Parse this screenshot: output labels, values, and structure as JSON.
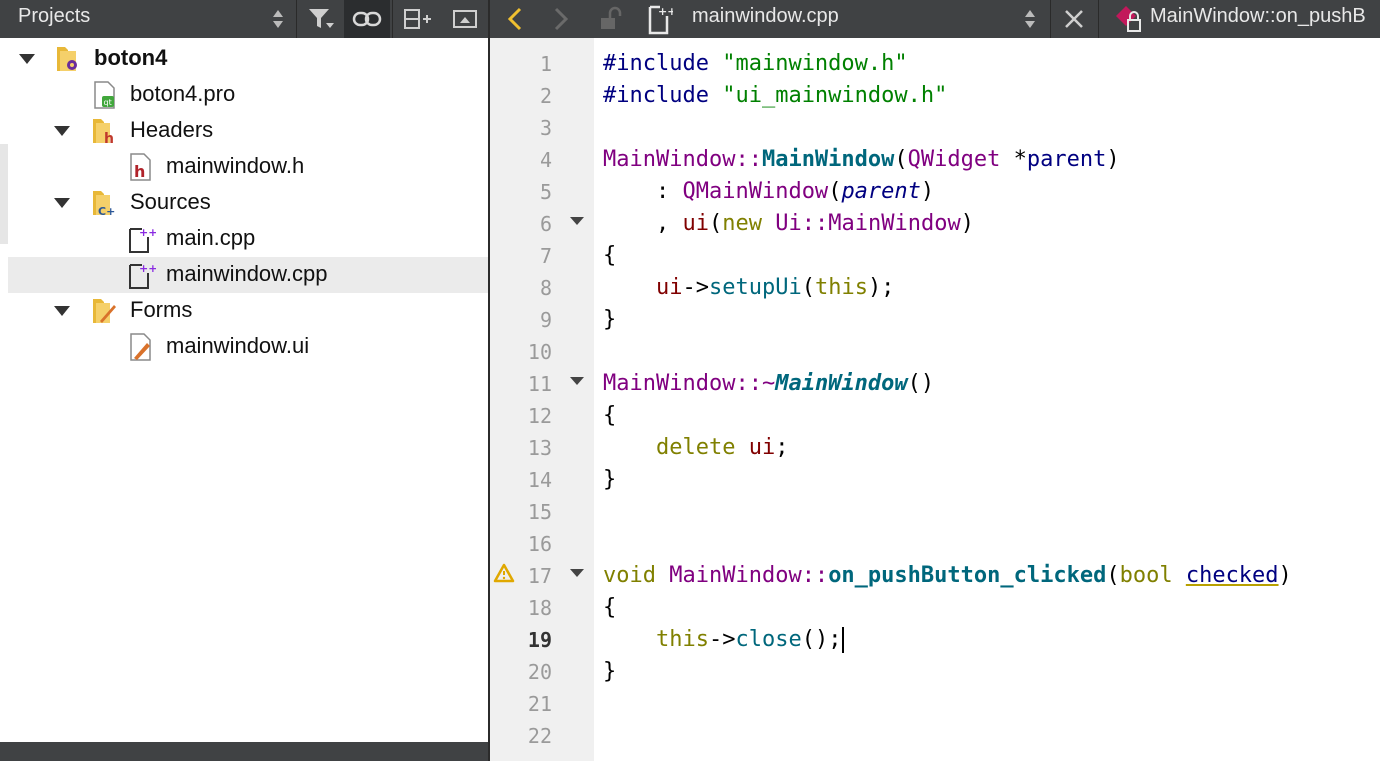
{
  "projects_panel": {
    "title": "Projects",
    "tree": [
      {
        "label": "boton4",
        "icon": "project-folder-icon",
        "expanded": true,
        "bold": true
      },
      {
        "label": "boton4.pro",
        "icon": "pro-file-icon"
      },
      {
        "label": "Headers",
        "icon": "headers-folder-icon",
        "expanded": true
      },
      {
        "label": "mainwindow.h",
        "icon": "header-file-icon"
      },
      {
        "label": "Sources",
        "icon": "sources-folder-icon",
        "expanded": true
      },
      {
        "label": "main.cpp",
        "icon": "cpp-file-icon"
      },
      {
        "label": "mainwindow.cpp",
        "icon": "cpp-file-icon",
        "selected": true
      },
      {
        "label": "Forms",
        "icon": "forms-folder-icon",
        "expanded": true
      },
      {
        "label": "mainwindow.ui",
        "icon": "ui-file-icon"
      }
    ]
  },
  "editor": {
    "file_name": "mainwindow.cpp",
    "function_name": "MainWindow::on_pushB",
    "current_line": "19",
    "line_numbers": [
      "1",
      "2",
      "3",
      "4",
      "5",
      "6",
      "7",
      "8",
      "9",
      "10",
      "11",
      "12",
      "13",
      "14",
      "15",
      "16",
      "17",
      "18",
      "19",
      "20",
      "21",
      "22"
    ],
    "code": {
      "l1a": "#include",
      "l1b": "\"mainwindow.h\"",
      "l2a": "#include",
      "l2b": "\"ui_mainwindow.h\"",
      "l4a": "MainWindow",
      "l4b": "::",
      "l4c": "MainWindow",
      "l4d": "(",
      "l4e": "QWidget",
      "l4f": " *",
      "l4g": "parent",
      "l4h": ")",
      "l5a": "    : ",
      "l5b": "QMainWindow",
      "l5c": "(",
      "l5d": "parent",
      "l5e": ")",
      "l6a": "    , ",
      "l6b": "ui",
      "l6c": "(",
      "l6d": "new",
      "l6e": " ",
      "l6f": "Ui",
      "l6g": "::",
      "l6h": "MainWindow",
      "l6i": ")",
      "l7": "{",
      "l8a": "    ",
      "l8b": "ui",
      "l8c": "->",
      "l8d": "setupUi",
      "l8e": "(",
      "l8f": "this",
      "l8g": ");",
      "l9": "}",
      "l11a": "MainWindow",
      "l11b": "::~",
      "l11c": "MainWindow",
      "l11d": "()",
      "l12": "{",
      "l13a": "    ",
      "l13b": "delete",
      "l13c": " ",
      "l13d": "ui",
      "l13e": ";",
      "l14": "}",
      "l17a": "void",
      "l17b": " ",
      "l17c": "MainWindow",
      "l17d": "::",
      "l17e": "on_pushButton_clicked",
      "l17f": "(",
      "l17g": "bool",
      "l17h": " ",
      "l17i": "checked",
      "l17j": ")",
      "l18": "{",
      "l19a": "    ",
      "l19b": "this",
      "l19c": "->",
      "l19d": "close",
      "l19e": "();",
      "l20": "}"
    }
  }
}
